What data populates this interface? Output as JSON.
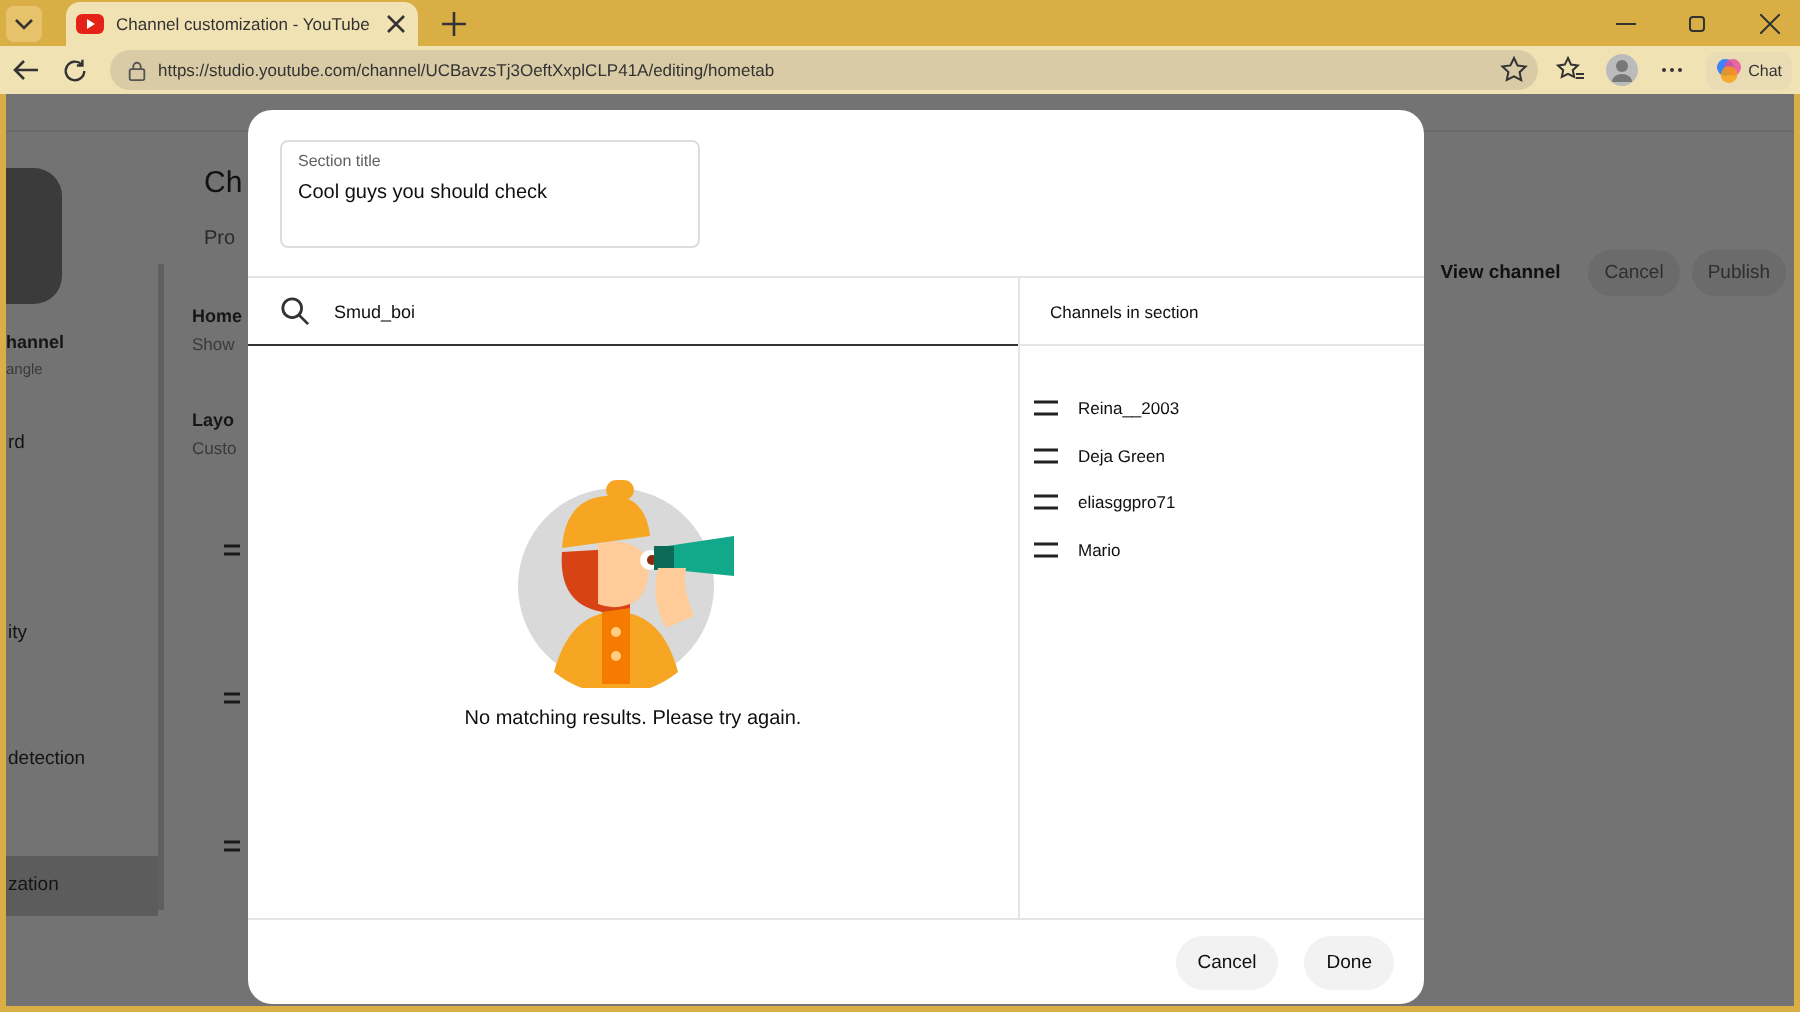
{
  "browser": {
    "tabs": [
      {
        "title": "Channel customization - YouTube",
        "selected": true
      }
    ],
    "url": "https://studio.youtube.com/channel/UCBavzsTj3OeftXxplCLP41A/editing/hometab",
    "chat_button": "Chat"
  },
  "background_page": {
    "sidebar": {
      "channel_name": "hannel",
      "channel_sub": "angle",
      "items": [
        {
          "label": "rd",
          "selected": false
        },
        {
          "label": "ity",
          "selected": false
        },
        {
          "label": "detection",
          "selected": false
        },
        {
          "label": "zation",
          "selected": true
        }
      ]
    },
    "title": "Ch",
    "tab": "Pro",
    "home_heading": "Home",
    "home_desc": "Show",
    "layout_heading": "Layo",
    "layout_desc": "Custo",
    "header_buttons": [
      {
        "label": "View channel",
        "kind": "text"
      },
      {
        "label": "Cancel",
        "kind": "filled"
      },
      {
        "label": "Publish",
        "kind": "filled"
      }
    ]
  },
  "dialog": {
    "section_title": {
      "label": "Section title",
      "value": "Cool guys you should check"
    },
    "search": {
      "value": "Smud_boi"
    },
    "empty_state": {
      "message": "No matching results. Please try again."
    },
    "channels_panel": {
      "heading": "Channels in section",
      "channels": [
        {
          "name": "Reina__2003"
        },
        {
          "name": "Deja Green"
        },
        {
          "name": "eliasggpro71"
        },
        {
          "name": "Mario"
        }
      ]
    },
    "buttons": [
      "Cancel",
      "Done"
    ]
  }
}
